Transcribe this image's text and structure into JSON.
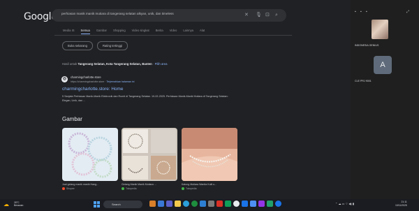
{
  "google": {
    "logo": "Google",
    "query": "perhiasan manik manik mutiara di tangerang selatan alkyan, unik, dan timeless",
    "tabs": [
      "Media IS",
      "Semua",
      "Gambar",
      "Shopping",
      "Video singkat",
      "Berita",
      "Video",
      "Lainnya",
      "Alat"
    ],
    "chips": [
      "Buka sekarang",
      "Rating tertinggi"
    ],
    "location": {
      "prefix": "Hasil untuk",
      "place": "Tangerang Selatan, Kota Tangerang Selatan, Banten",
      "link": "Pilih area"
    },
    "result": {
      "site": "charmingcharlotte.store",
      "url": "https://charmingcharlotte.store",
      "translate": "Terjemahkan halaman ini",
      "title": "charmingcharlotte.store: Home",
      "snippet": "5 Sanjata Perhiasan Manik-Manik Elektronik dan Rumit di Tangerang Selatan. 10-02-2025. Perhiasan Manik-Manik Mutiara di Tangerang Selatan: Elegan, Unik, dan ..."
    },
    "images_heading": "Gambar",
    "image_cards": [
      {
        "caption": "Jual gelang manik manik Hang...",
        "source": "Shopee",
        "dot_color": "#ee4d2d"
      },
      {
        "caption": "Gelang Manik Manik Mutiara ...",
        "source": "Tokopedia",
        "dot_color": "#42b549"
      },
      {
        "caption": "Kalung Mutiara Wanita Kulit u...",
        "source": "Tokopedia",
        "dot_color": "#42b549"
      }
    ]
  },
  "meet": {
    "participant1": "INDONESIA GENIUS",
    "participant2_initial": "A",
    "participant2": "CLE PRJ 9001"
  },
  "taskbar": {
    "weather_temp": "28°C",
    "weather_desc": "Berawan",
    "search_label": "Search",
    "time": "21:11",
    "date": "10/11/2025"
  }
}
